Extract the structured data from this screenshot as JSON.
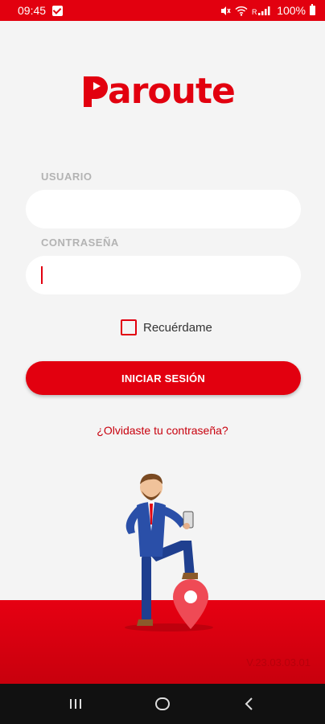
{
  "status_bar": {
    "time": "09:45",
    "battery": "100%",
    "icons": [
      "check-notification-icon",
      "mute-icon",
      "wifi-icon",
      "signal-icon",
      "battery-icon"
    ]
  },
  "brand": {
    "name": "aroute",
    "accent": "#e2000f"
  },
  "form": {
    "username_label": "USUARIO",
    "username_value": "",
    "password_label": "CONTRASEÑA",
    "password_value": "",
    "remember_label": "Recuérdame",
    "remember_checked": false,
    "login_button": "INICIAR SESIÓN",
    "forgot_link": "¿Olvidaste tu contraseña?"
  },
  "footer": {
    "version": "V.23.03.03.01"
  },
  "nav": {
    "icons": [
      "recent-apps-icon",
      "home-icon",
      "back-icon"
    ]
  }
}
